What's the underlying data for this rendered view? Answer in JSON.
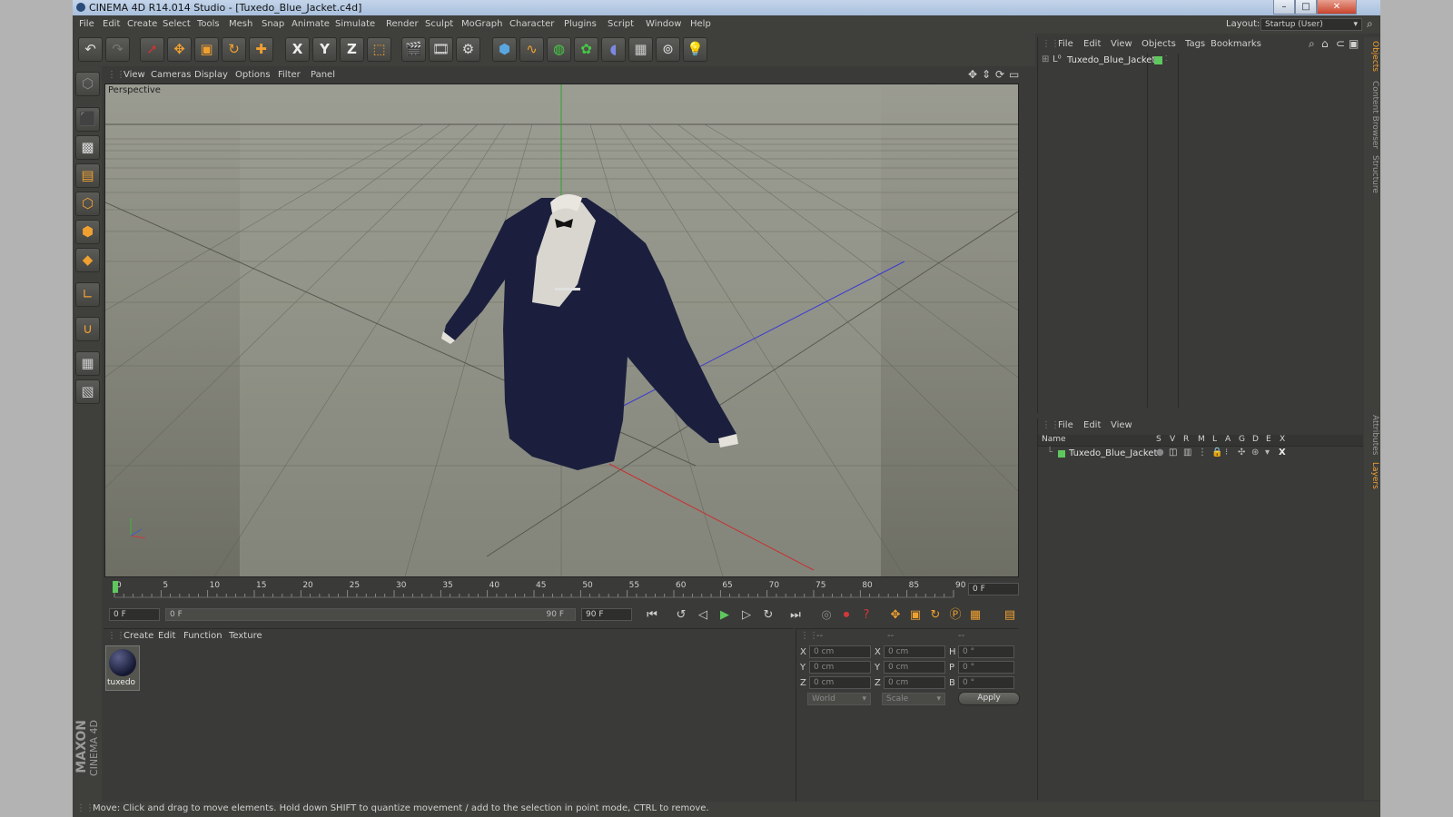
{
  "window": {
    "title": "CINEMA 4D R14.014 Studio - [Tuxedo_Blue_Jacket.c4d]",
    "layout_label": "Layout:",
    "layout_value": "Startup (User)"
  },
  "menu": [
    "File",
    "Edit",
    "Create",
    "Select",
    "Tools",
    "Mesh",
    "Snap",
    "Animate",
    "Simulate",
    "Render",
    "Sculpt",
    "MoGraph",
    "Character",
    "Plugins",
    "Script",
    "Window",
    "Help"
  ],
  "toolbar": {
    "icons": [
      "undo-icon",
      "redo-icon",
      "live-selection-icon",
      "move-icon",
      "scale-icon",
      "rotate-icon",
      "last-tool-icon",
      "x-axis-icon",
      "y-axis-icon",
      "z-axis-icon",
      "coordinate-system-icon",
      "render-view-icon",
      "render-picture-viewer-icon",
      "render-settings-icon",
      "cube-icon",
      "spline-pen-icon",
      "subdivision-icon",
      "cloner-icon",
      "deformer-icon",
      "floor-icon",
      "camera-icon",
      "light-icon"
    ],
    "axis_x": "X",
    "axis_y": "Y",
    "axis_z": "Z"
  },
  "viewport": {
    "menu": [
      "View",
      "Cameras",
      "Display",
      "Options",
      "Filter",
      "Panel"
    ],
    "label": "Perspective"
  },
  "timeline": {
    "ticks": [
      "0",
      "5",
      "10",
      "15",
      "20",
      "25",
      "30",
      "35",
      "40",
      "45",
      "50",
      "55",
      "60",
      "65",
      "70",
      "75",
      "80",
      "85",
      "90"
    ],
    "current_frame": "0 F",
    "start_frame": "0 F",
    "range_start": "0 F",
    "range_end": "90 F",
    "end_frame": "90 F"
  },
  "material_manager": {
    "menu": [
      "Create",
      "Edit",
      "Function",
      "Texture"
    ],
    "material_name": "tuxedo"
  },
  "coordinates": {
    "header": [
      "--",
      "--",
      "--"
    ],
    "rows": [
      {
        "a": "X",
        "av": "0 cm",
        "b": "X",
        "bv": "0 cm",
        "c": "H",
        "cv": "0 °"
      },
      {
        "a": "Y",
        "av": "0 cm",
        "b": "Y",
        "bv": "0 cm",
        "c": "P",
        "cv": "0 °"
      },
      {
        "a": "Z",
        "av": "0 cm",
        "b": "Z",
        "bv": "0 cm",
        "c": "B",
        "cv": "0 °"
      }
    ],
    "world": "World",
    "scale": "Scale",
    "apply": "Apply"
  },
  "object_manager": {
    "menu": [
      "File",
      "Edit",
      "View",
      "Objects",
      "Tags",
      "Bookmarks"
    ],
    "object": "Tuxedo_Blue_Jacket"
  },
  "layer_manager": {
    "menu": [
      "File",
      "Edit",
      "View"
    ],
    "name_header": "Name",
    "columns": [
      "S",
      "V",
      "R",
      "M",
      "L",
      "A",
      "G",
      "D",
      "E",
      "X"
    ],
    "layer": "Tuxedo_Blue_Jacket"
  },
  "side_tabs": [
    "Objects",
    "Content Browser",
    "Structure",
    "Attributes",
    "Layers"
  ],
  "brand": {
    "line1": "MAXON",
    "line2": "CINEMA 4D"
  },
  "status": "Move: Click and drag to move elements. Hold down SHIFT to quantize movement / add to the selection in point mode, CTRL to remove.",
  "colors": {
    "accent": "#f0a030",
    "green": "#5ec85e",
    "jacket": "#1b1f3d"
  }
}
